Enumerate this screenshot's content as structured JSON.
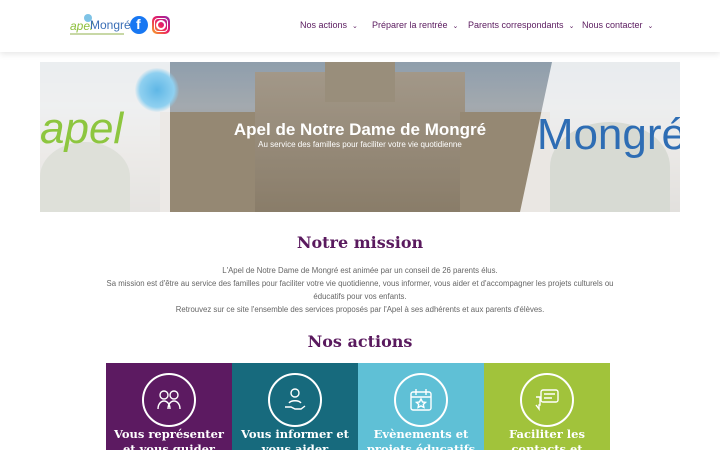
{
  "header": {
    "logo_apel": "apel",
    "logo_mongre": "Mongré",
    "social": [
      "facebook-icon",
      "instagram-icon"
    ],
    "nav": [
      {
        "label": "Nos actions"
      },
      {
        "label": "Préparer la rentrée"
      },
      {
        "label": "Parents correspondants"
      },
      {
        "label": "Nous contacter"
      }
    ]
  },
  "hero": {
    "word_left": "apel",
    "word_right": "Mongré",
    "title": "Apel de Notre Dame de Mongré",
    "subtitle": "Au service des familles pour faciliter votre vie quotidienne"
  },
  "mission": {
    "title": "Notre mission",
    "p1": "L'Apel de Notre Dame de Mongré est animée par un conseil de 26 parents élus.",
    "p2": "Sa mission est d'être au service des familles pour faciliter votre vie quotidienne, vous informer, vous aider et d'accompagner les projets culturels ou éducatifs pour vos enfants.",
    "p3": "Retrouvez sur ce site l'ensemble des services proposés par l'Apel à ses adhérents et aux parents d'élèves."
  },
  "actions": {
    "title": "Nos actions",
    "cards": [
      {
        "title": "Vous représenter et vous guider",
        "icon": "parents-icon",
        "color": "#5c1a61"
      },
      {
        "title": "Vous informer et vous aider",
        "icon": "helping-hand-icon",
        "color": "#176a7d"
      },
      {
        "title": "Evènements et projets éducatifs",
        "icon": "calendar-icon",
        "color": "#5fc0d6"
      },
      {
        "title": "Faciliter les contacts et",
        "icon": "chat-icon",
        "color": "#a1c33b"
      }
    ]
  },
  "colors": {
    "brand_purple": "#5a1a5e",
    "apel_green": "#8dc63f",
    "mongre_blue": "#2e6db4"
  }
}
